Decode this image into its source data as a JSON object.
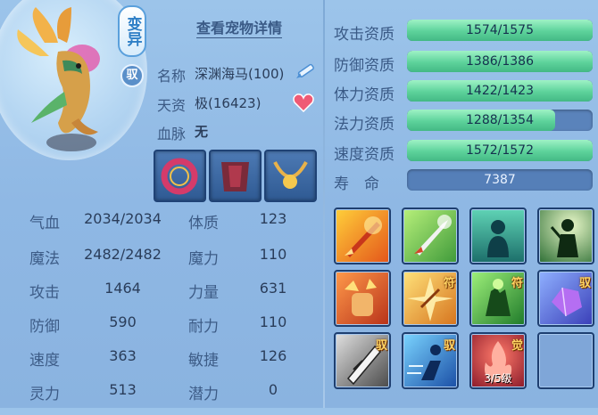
{
  "pet": {
    "variant_badge": "变异",
    "ride_badge": "驭",
    "detail_link": "查看宠物详情",
    "name_label": "名称",
    "name_value": "深渊海马(100)",
    "aptitude_label": "天资",
    "aptitude_value": "极(16423)",
    "bloodline_label": "血脉",
    "bloodline_value": "无"
  },
  "equipment": [
    {
      "name": "collar-equip",
      "color": "#c8325a"
    },
    {
      "name": "armor-equip",
      "color": "#7a2a3a"
    },
    {
      "name": "necklace-equip",
      "color": "#e7b84a"
    }
  ],
  "stats": [
    {
      "left_label": "气血",
      "left_value": "2034/2034",
      "right_label": "体质",
      "right_value": "123"
    },
    {
      "left_label": "魔法",
      "left_value": "2482/2482",
      "right_label": "魔力",
      "right_value": "110"
    },
    {
      "left_label": "攻击",
      "left_value": "1464",
      "right_label": "力量",
      "right_value": "631"
    },
    {
      "left_label": "防御",
      "left_value": "590",
      "right_label": "耐力",
      "right_value": "110"
    },
    {
      "left_label": "速度",
      "left_value": "363",
      "right_label": "敏捷",
      "right_value": "126"
    },
    {
      "left_label": "灵力",
      "left_value": "513",
      "right_label": "潜力",
      "right_value": "0"
    }
  ],
  "aptitudes": [
    {
      "label": "攻击资质",
      "text": "1574/1575",
      "fill": 0.999
    },
    {
      "label": "防御资质",
      "text": "1386/1386",
      "fill": 1.0
    },
    {
      "label": "体力资质",
      "text": "1422/1423",
      "fill": 0.999
    },
    {
      "label": "法力资质",
      "text": "1288/1354",
      "fill": 0.8
    },
    {
      "label": "速度资质",
      "text": "1572/1572",
      "fill": 1.0
    }
  ],
  "lifespan": {
    "label": "寿　命",
    "value": "7387"
  },
  "skills": [
    {
      "name": "skill-fire-sword",
      "badge": "",
      "level": ""
    },
    {
      "name": "skill-holy-sword",
      "badge": "",
      "level": ""
    },
    {
      "name": "skill-spirit-body",
      "badge": "",
      "level": ""
    },
    {
      "name": "skill-shadow-knight",
      "badge": "",
      "level": ""
    },
    {
      "name": "skill-flame-fist",
      "badge": "",
      "level": ""
    },
    {
      "name": "skill-golden-strike",
      "badge": "符",
      "level": ""
    },
    {
      "name": "skill-poison-hand",
      "badge": "符",
      "level": ""
    },
    {
      "name": "skill-crystal-gem",
      "badge": "驭",
      "level": ""
    },
    {
      "name": "skill-blade-shield",
      "badge": "驭",
      "level": ""
    },
    {
      "name": "skill-dash",
      "badge": "驭",
      "level": ""
    },
    {
      "name": "skill-awaken-fire",
      "badge": "觉",
      "level": "3/5级"
    },
    {
      "name": "skill-empty-slot",
      "badge": "",
      "level": ""
    }
  ],
  "colors": {
    "background": "#8fb8e4",
    "bar_green": "#5dd29b",
    "label_blue": "#3a5a86"
  }
}
